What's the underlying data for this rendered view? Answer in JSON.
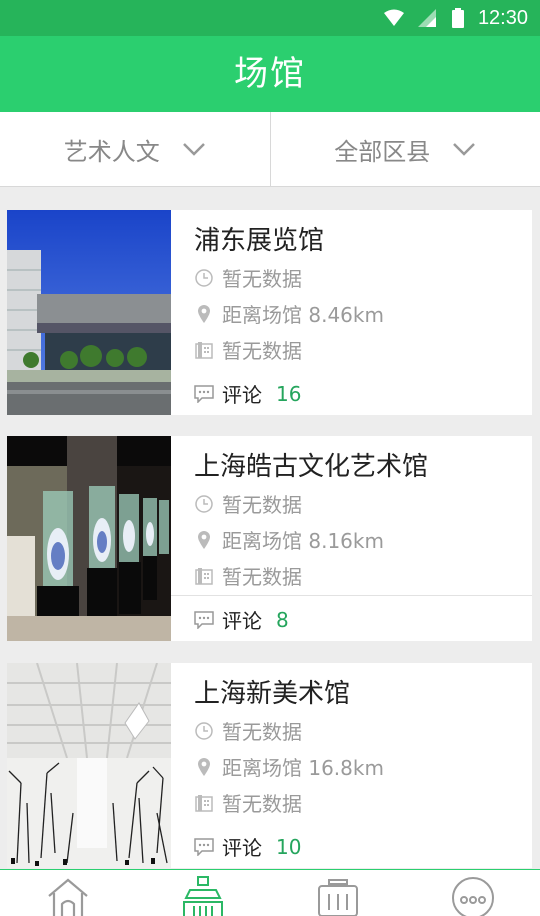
{
  "status_bar": {
    "time": "12:30"
  },
  "header": {
    "title": "场馆"
  },
  "filters": [
    {
      "label": "艺术人文"
    },
    {
      "label": "全部区县"
    }
  ],
  "venues": [
    {
      "name": "浦东展览馆",
      "hours": "暂无数据",
      "distance": "距离场馆 8.46km",
      "phone": "暂无数据",
      "comment_label": "评论",
      "comment_count": "16"
    },
    {
      "name": "上海皓古文化艺术馆",
      "hours": "暂无数据",
      "distance": "距离场馆 8.16km",
      "phone": "暂无数据",
      "comment_label": "评论",
      "comment_count": "8"
    },
    {
      "name": "上海新美术馆",
      "hours": "暂无数据",
      "distance": "距离场馆 16.8km",
      "phone": "暂无数据",
      "comment_label": "评论",
      "comment_count": "10"
    }
  ],
  "tab_bar": {
    "tabs": [
      {
        "icon": "home-icon"
      },
      {
        "icon": "venue-building-icon",
        "active": true
      },
      {
        "icon": "activity-icon"
      },
      {
        "icon": "more-icon"
      }
    ]
  },
  "colors": {
    "status_bar": "#26b45a",
    "header": "#2bcf6f",
    "accent": "#25a55d"
  }
}
